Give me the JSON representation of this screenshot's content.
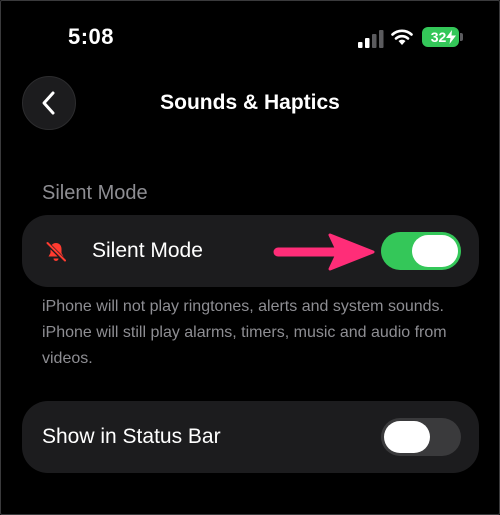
{
  "status_bar": {
    "time": "5:08",
    "battery_level": "32",
    "icons": [
      "cellular-signal-icon",
      "wifi-icon",
      "battery-icon",
      "charging-bolt-icon"
    ]
  },
  "nav": {
    "back_icon": "chevron-left-icon",
    "title": "Sounds & Haptics"
  },
  "silent_section": {
    "header": "Silent Mode",
    "row": {
      "icon": "bell-slash-icon",
      "label": "Silent Mode",
      "toggle_on": true
    },
    "footer": "iPhone will not play ringtones, alerts and system sounds. iPhone will still play alarms, timers, music and audio from videos."
  },
  "status_row": {
    "label": "Show in Status Bar",
    "toggle_on": false
  },
  "annotation": {
    "icon": "pointer-arrow-icon"
  },
  "colors": {
    "background": "#000000",
    "card": "#1c1c1e",
    "toggle_on": "#34c759",
    "toggle_off": "#3a3a3c",
    "secondary_text": "#8e8e93",
    "silent_icon": "#ff3b30",
    "annotation_arrow": "#ff2d78"
  }
}
